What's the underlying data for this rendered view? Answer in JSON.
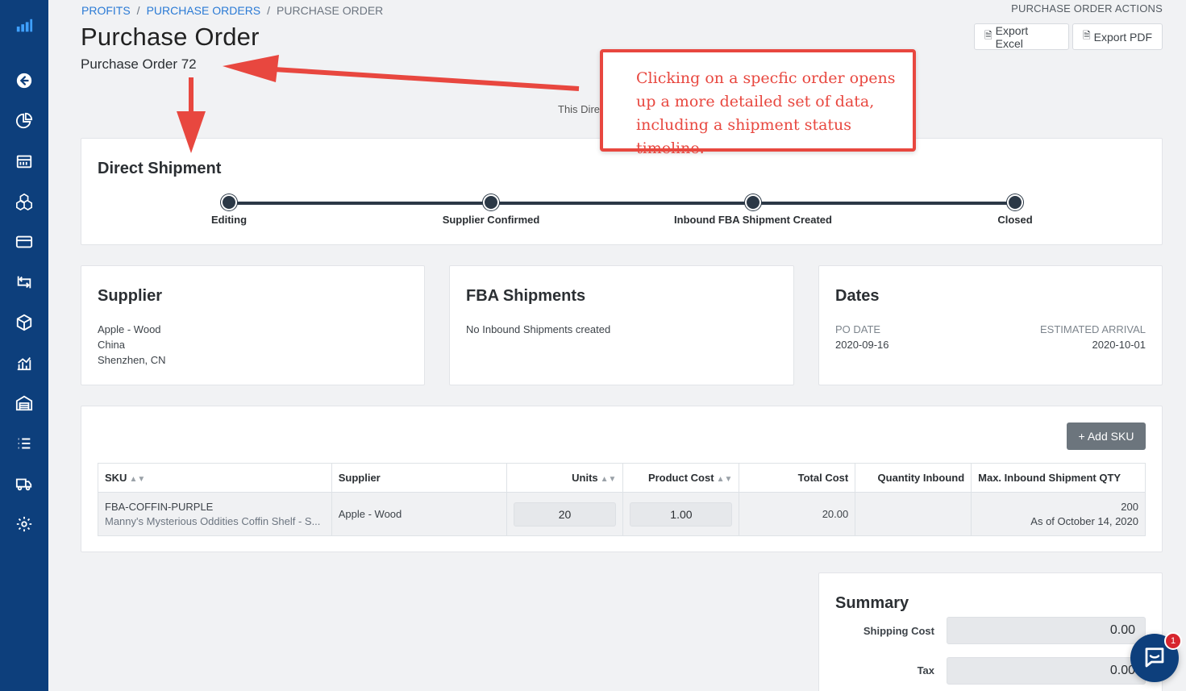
{
  "breadcrumb": {
    "profits": "PROFITS",
    "purchase_orders": "PURCHASE ORDERS",
    "current": "PURCHASE ORDER",
    "sep": "/"
  },
  "header": {
    "title": "Purchase Order",
    "subtitle": "Purchase Order 72",
    "actions_label": "PURCHASE ORDER ACTIONS",
    "export_excel": "Export Excel",
    "export_pdf": "Export PDF",
    "hint": "This Dire"
  },
  "shipment": {
    "title": "Direct Shipment",
    "steps": [
      "Editing",
      "Supplier Confirmed",
      "Inbound FBA Shipment Created",
      "Closed"
    ]
  },
  "supplier": {
    "title": "Supplier",
    "name": "Apple - Wood",
    "country": "China",
    "city": "Shenzhen, CN"
  },
  "fba": {
    "title": "FBA Shipments",
    "message": "No Inbound Shipments created"
  },
  "dates": {
    "title": "Dates",
    "po_date_label": "PO DATE",
    "po_date": "2020-09-16",
    "eta_label": "ESTIMATED ARRIVAL",
    "eta": "2020-10-01"
  },
  "table": {
    "add_sku": "+ Add SKU",
    "headers": [
      "SKU",
      "Supplier",
      "Units",
      "Product Cost",
      "Total Cost",
      "Quantity Inbound",
      "Max. Inbound Shipment QTY"
    ],
    "row": {
      "sku": "FBA-COFFIN-PURPLE",
      "description": "Manny's Mysterious Oddities Coffin Shelf - S...",
      "supplier": "Apple - Wood",
      "units": "20",
      "product_cost": "1.00",
      "total_cost": "20.00",
      "quantity_inbound": "",
      "max_qty": "200",
      "max_qty_date": "As of October 14, 2020"
    }
  },
  "summary": {
    "title": "Summary",
    "shipping_label": "Shipping Cost",
    "shipping_value": "0.00",
    "tax_label": "Tax",
    "tax_value": "0.00"
  },
  "annotation": {
    "text": "Clicking on a specfic order opens up a more detailed set of data, including a shipment status timeline.",
    "color": "#e8473f"
  },
  "chat": {
    "badge": "1"
  },
  "colors": {
    "sidebar": "#0d3f7c",
    "link": "#2a7ad5",
    "timeline": "#2b3846",
    "add_button": "#6c757d"
  },
  "icons": [
    "logo-icon",
    "back-icon",
    "chart-pie-icon",
    "calendar-icon",
    "boxes-icon",
    "credit-card-icon",
    "repeat-icon",
    "package-icon",
    "analytics-icon",
    "warehouse-icon",
    "list-icon",
    "truck-icon",
    "gear-icon"
  ]
}
